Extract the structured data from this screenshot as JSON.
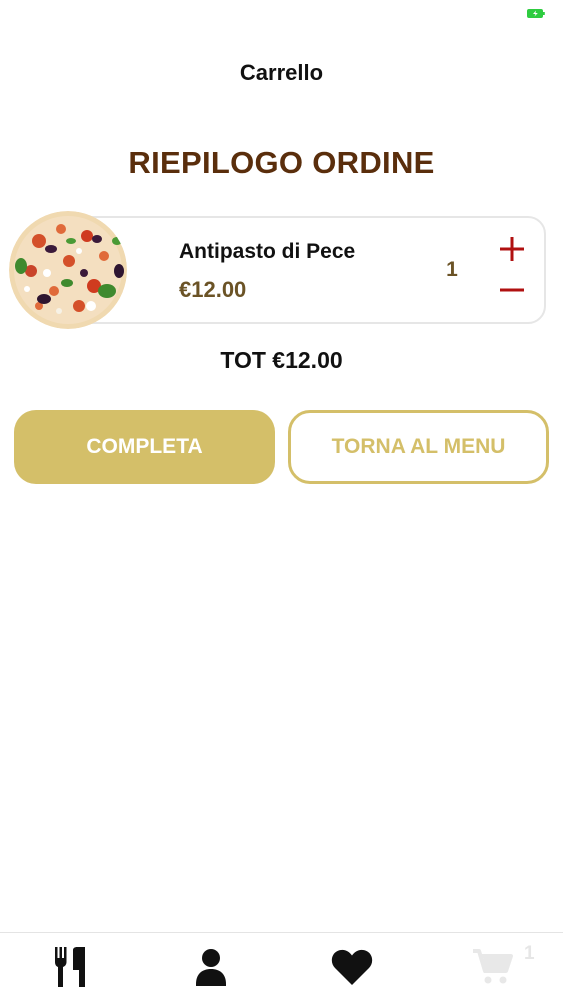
{
  "status_bar": {
    "battery_color": "#2ecc40",
    "battery_icon": "battery-charging-icon"
  },
  "header": {
    "title": "Carrello"
  },
  "summary": {
    "title": "RIEPILOGO ORDINE"
  },
  "cart_items": [
    {
      "name": "Antipasto di Pece",
      "price": "€12.00",
      "quantity": "1",
      "image_icon": "pizza-image"
    }
  ],
  "total": {
    "label": "TOT €12.00"
  },
  "actions": {
    "complete_label": "COMPLETA",
    "back_to_menu_label": "TORNA AL MENU"
  },
  "tab_bar": {
    "items": [
      {
        "icon": "fork-knife-icon"
      },
      {
        "icon": "user-icon"
      },
      {
        "icon": "heart-icon"
      },
      {
        "icon": "cart-icon"
      }
    ],
    "cart_badge": "1"
  },
  "colors": {
    "accent_gold": "#d4bf69",
    "title_brown": "#5a2e0c",
    "price_brown": "#6b5326",
    "qty_red": "#b01010"
  }
}
